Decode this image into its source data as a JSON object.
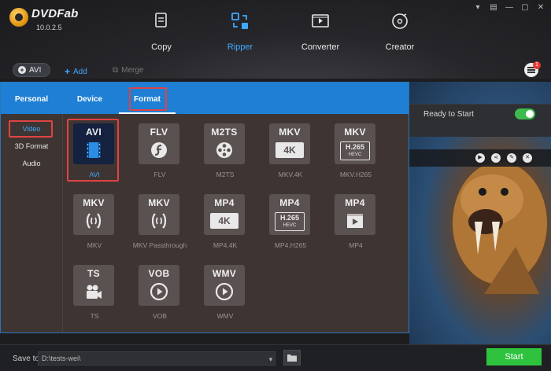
{
  "app": {
    "name": "DVDFab",
    "version": "10.0.2.5"
  },
  "modes": [
    {
      "label": "Copy",
      "icon": "copy-icon",
      "active": false
    },
    {
      "label": "Ripper",
      "icon": "ripper-icon",
      "active": true
    },
    {
      "label": "Converter",
      "icon": "converter-icon",
      "active": false
    },
    {
      "label": "Creator",
      "icon": "creator-icon",
      "active": false
    }
  ],
  "toolbar": {
    "profile_label": "AVI",
    "add_label": "Add",
    "merge_label": "Merge",
    "notification_count": "1"
  },
  "popup": {
    "tabs": [
      "Personal",
      "Device",
      "Format"
    ],
    "active_tab": "Format",
    "categories": [
      "Video",
      "3D Format",
      "Audio"
    ],
    "active_category": "Video",
    "formats": [
      {
        "code": "AVI",
        "label": "AVI",
        "glyph": "film-icon",
        "selected": true
      },
      {
        "code": "FLV",
        "label": "FLV",
        "glyph": "flash-icon",
        "selected": false
      },
      {
        "code": "M2TS",
        "label": "M2TS",
        "glyph": "reel-icon",
        "selected": false
      },
      {
        "code": "MKV",
        "label": "MKV.4K",
        "glyph": "4k-badge",
        "badge": "4K",
        "selected": false
      },
      {
        "code": "MKV",
        "label": "MKV.H265",
        "glyph": "h265-badge",
        "badge": "H.265",
        "sub_badge": "HEVC",
        "selected": false
      },
      {
        "code": "MKV",
        "label": "MKV",
        "glyph": "matroska-icon",
        "selected": false
      },
      {
        "code": "MKV",
        "label": "MKV Passthrough",
        "glyph": "matroska-icon",
        "selected": false
      },
      {
        "code": "MP4",
        "label": "MP4.4K",
        "glyph": "4k-badge",
        "badge": "4K",
        "selected": false
      },
      {
        "code": "MP4",
        "label": "MP4.H265",
        "glyph": "h265-badge",
        "badge": "H.265",
        "sub_badge": "HEVC",
        "selected": false
      },
      {
        "code": "MP4",
        "label": "MP4",
        "glyph": "play-box-icon",
        "selected": false
      },
      {
        "code": "TS",
        "label": "TS",
        "glyph": "camera-icon",
        "selected": false
      },
      {
        "code": "VOB",
        "label": "VOB",
        "glyph": "play-circle-icon",
        "selected": false
      },
      {
        "code": "WMV",
        "label": "WMV",
        "glyph": "play-circle-icon",
        "selected": false
      }
    ]
  },
  "task": {
    "status": "Ready to Start",
    "enabled": true
  },
  "bottom": {
    "save_label": "Save to:",
    "save_path": "D:\\tests-wei\\",
    "start_label": "Start"
  },
  "colors": {
    "accent": "#1e7fd4",
    "highlight_blue": "#3fa9ff",
    "start_green": "#2fc23e",
    "annotation_red": "#e04343"
  }
}
